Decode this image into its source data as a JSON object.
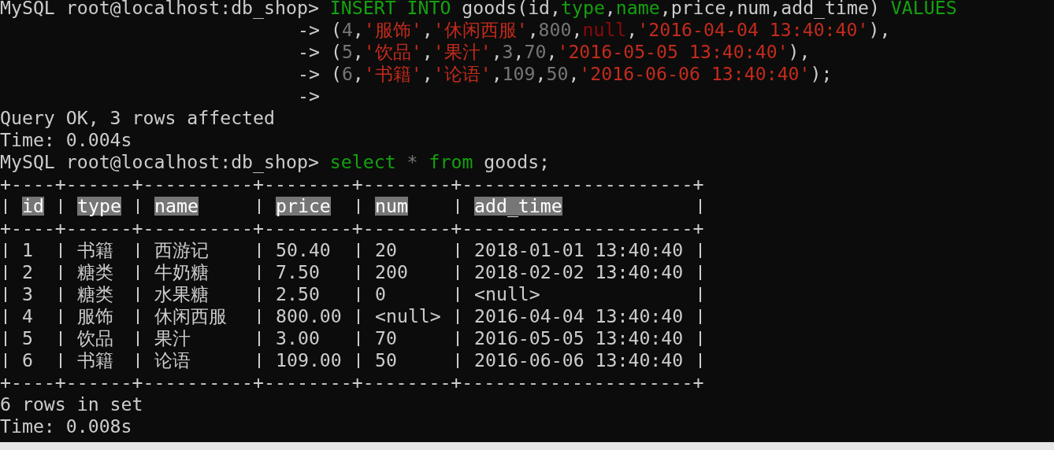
{
  "terminal": {
    "lines": [
      {
        "kind": "command",
        "prompt": "MySQL root@localhost:db_shop>",
        "tokens": [
          {
            "text": "INSERT INTO",
            "kind": "keyword"
          },
          {
            "text": " goods(id,",
            "kind": "plain"
          },
          {
            "text": "type",
            "kind": "keyword"
          },
          {
            "text": ",",
            "kind": "plain"
          },
          {
            "text": "name",
            "kind": "keyword"
          },
          {
            "text": ",price,num,add_time) ",
            "kind": "plain"
          },
          {
            "text": "VALUES",
            "kind": "keyword"
          }
        ]
      },
      {
        "kind": "continuation",
        "prompt": "->",
        "tokens": [
          {
            "text": "(",
            "kind": "plain"
          },
          {
            "text": "4",
            "kind": "number"
          },
          {
            "text": ",",
            "kind": "plain"
          },
          {
            "text": "'服饰'",
            "kind": "string"
          },
          {
            "text": ",",
            "kind": "plain"
          },
          {
            "text": "'休闲西服'",
            "kind": "string"
          },
          {
            "text": ",",
            "kind": "plain"
          },
          {
            "text": "800",
            "kind": "number"
          },
          {
            "text": ",",
            "kind": "plain"
          },
          {
            "text": "null",
            "kind": "null"
          },
          {
            "text": ",",
            "kind": "plain"
          },
          {
            "text": "'2016-04-04 13:40:40'",
            "kind": "string"
          },
          {
            "text": "),",
            "kind": "plain"
          }
        ]
      },
      {
        "kind": "continuation",
        "prompt": "->",
        "tokens": [
          {
            "text": "(",
            "kind": "plain"
          },
          {
            "text": "5",
            "kind": "number"
          },
          {
            "text": ",",
            "kind": "plain"
          },
          {
            "text": "'饮品'",
            "kind": "string"
          },
          {
            "text": ",",
            "kind": "plain"
          },
          {
            "text": "'果汁'",
            "kind": "string"
          },
          {
            "text": ",",
            "kind": "plain"
          },
          {
            "text": "3",
            "kind": "number"
          },
          {
            "text": ",",
            "kind": "plain"
          },
          {
            "text": "70",
            "kind": "number"
          },
          {
            "text": ",",
            "kind": "plain"
          },
          {
            "text": "'2016-05-05 13:40:40'",
            "kind": "string"
          },
          {
            "text": "),",
            "kind": "plain"
          }
        ]
      },
      {
        "kind": "continuation",
        "prompt": "->",
        "tokens": [
          {
            "text": "(",
            "kind": "plain"
          },
          {
            "text": "6",
            "kind": "number"
          },
          {
            "text": ",",
            "kind": "plain"
          },
          {
            "text": "'书籍'",
            "kind": "string"
          },
          {
            "text": ",",
            "kind": "plain"
          },
          {
            "text": "'论语'",
            "kind": "string"
          },
          {
            "text": ",",
            "kind": "plain"
          },
          {
            "text": "109",
            "kind": "number"
          },
          {
            "text": ",",
            "kind": "plain"
          },
          {
            "text": "50",
            "kind": "number"
          },
          {
            "text": ",",
            "kind": "plain"
          },
          {
            "text": "'2016-06-06 13:40:40'",
            "kind": "string"
          },
          {
            "text": ");",
            "kind": "plain"
          }
        ]
      },
      {
        "kind": "continuation",
        "prompt": "->"
      },
      {
        "kind": "output",
        "text": "Query OK, 3 rows affected"
      },
      {
        "kind": "output",
        "text": "Time: 0.004s"
      },
      {
        "kind": "command",
        "prompt": "MySQL root@localhost:db_shop>",
        "tokens": [
          {
            "text": "select",
            "kind": "keyword"
          },
          {
            "text": " * ",
            "kind": "operator"
          },
          {
            "text": "from",
            "kind": "keyword"
          },
          {
            "text": " goods;",
            "kind": "plain"
          }
        ]
      },
      {
        "kind": "table",
        "top_border": "+----+------+----------+--------+--------+---------------------+",
        "columns": [
          "id",
          "type",
          "name",
          "price",
          "num",
          "add_time"
        ],
        "header_border": "+----+------+----------+--------+--------+---------------------+",
        "rows": [
          [
            "1",
            "书籍",
            "西游记",
            "50.40",
            "20",
            "2018-01-01 13:40:40"
          ],
          [
            "2",
            "糖类",
            "牛奶糖",
            "7.50",
            "200",
            "2018-02-02 13:40:40"
          ],
          [
            "3",
            "糖类",
            "水果糖",
            "2.50",
            "0",
            "<null>"
          ],
          [
            "4",
            "服饰",
            "休闲西服",
            "800.00",
            "<null>",
            "2016-04-04 13:40:40"
          ],
          [
            "5",
            "饮品",
            "果汁",
            "3.00",
            "70",
            "2016-05-05 13:40:40"
          ],
          [
            "6",
            "书籍",
            "论语",
            "109.00",
            "50",
            "2016-06-06 13:40:40"
          ]
        ],
        "bottom_border": "+----+------+----------+--------+--------+---------------------+"
      },
      {
        "kind": "output",
        "text": "6 rows in set"
      },
      {
        "kind": "output",
        "text": "Time: 0.008s"
      }
    ]
  }
}
